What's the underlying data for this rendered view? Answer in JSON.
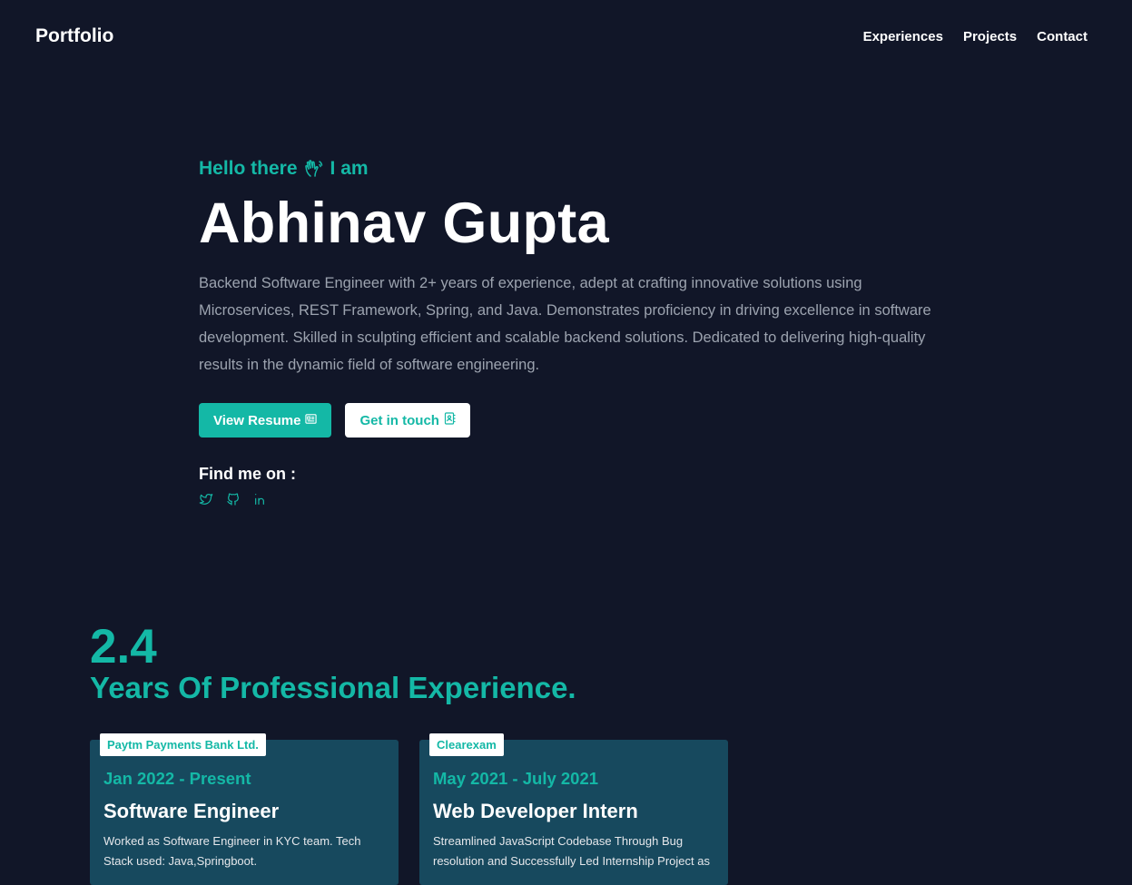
{
  "nav": {
    "brand": "Portfolio",
    "links": [
      "Experiences",
      "Projects",
      "Contact"
    ]
  },
  "hero": {
    "greeting_prefix": "Hello there",
    "greeting_suffix": "I am",
    "greeting_icon": "waving-hand-icon",
    "name": "Abhinav Gupta",
    "bio": "Backend Software Engineer with 2+ years of experience, adept at crafting innovative solutions using Microservices, REST Framework, Spring, and Java. Demonstrates proficiency in driving excellence in software development. Skilled in sculpting efficient and scalable backend solutions. Dedicated to delivering high-quality results in the dynamic field of software engineering.",
    "resume_label": "View Resume",
    "resume_icon": "newspaper-icon",
    "contact_label": "Get in touch",
    "contact_icon": "address-book-icon",
    "find_label": "Find me on :",
    "socials": [
      "twitter-icon",
      "github-icon",
      "linkedin-icon"
    ]
  },
  "experience": {
    "years": "2.4",
    "title": "Years Of Professional Experience.",
    "cards": [
      {
        "company": "Paytm Payments Bank Ltd.",
        "date": "Jan 2022 - Present",
        "role": "Software Engineer",
        "description": "Worked as Software Engineer in KYC team. Tech Stack used: Java,Springboot."
      },
      {
        "company": "Clearexam",
        "date": "May 2021 - July 2021",
        "role": "Web Developer Intern",
        "description": "Streamlined JavaScript Codebase Through Bug resolution and Successfully Led Internship Project as"
      }
    ]
  },
  "colors": {
    "background": "#111628",
    "accent": "#14b8a6",
    "card": "#17495e",
    "muted_text": "#9ca3af"
  }
}
